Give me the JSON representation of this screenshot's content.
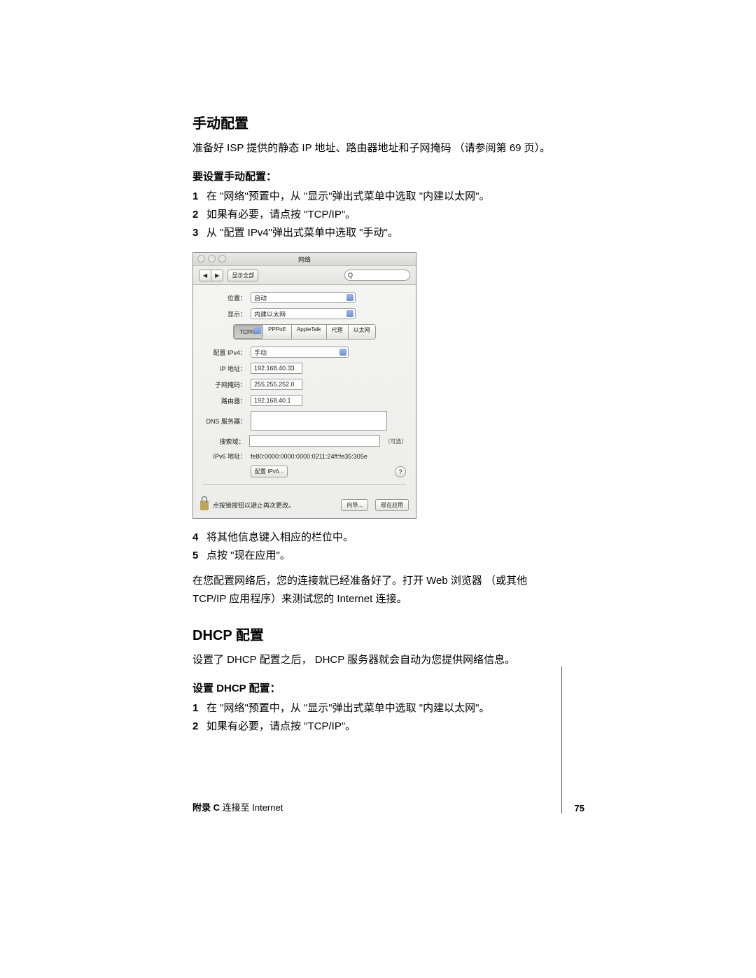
{
  "section1": {
    "title": "手动配置",
    "intro": "准备好 ISP 提供的静态 IP 地址、路由器地址和子网掩码 （请参阅第 69 页）。",
    "subtitle": "要设置手动配置：",
    "steps": [
      "在 \"网络\"预置中，从 \"显示\"弹出式菜单中选取 \"内建以太网\"。",
      "如果有必要，请点按 \"TCP/IP\"。",
      "从 \"配置 IPv4\"弹出式菜单中选取 \"手动\"。"
    ],
    "steps_after": [
      "将其他信息键入相应的栏位中。",
      "点按 \"现在应用\"。"
    ],
    "outro": "在您配置网络后，您的连接就已经准备好了。打开 Web 浏览器 （或其他 TCP/IP 应用程序）来测试您的 Internet 连接。"
  },
  "section2": {
    "title": "DHCP 配置",
    "intro": "设置了 DHCP 配置之后， DHCP 服务器就会自动为您提供网络信息。",
    "subtitle": "设置 DHCP 配置：",
    "steps": [
      "在 \"网络\"预置中，从 \"显示\"弹出式菜单中选取 \"内建以太网\"。",
      "如果有必要，请点按 \"TCP/IP\"。"
    ]
  },
  "shot": {
    "title": "网络",
    "showall": "显示全部",
    "nav_back": "◀",
    "nav_fwd": "▶",
    "search_placeholder": "Q",
    "location_label": "位置：",
    "location_value": "自动",
    "show_label": "显示：",
    "show_value": "内建以太网",
    "tabs": [
      "TCP/IP",
      "PPPoE",
      "AppleTalk",
      "代理",
      "以太网"
    ],
    "ipv4config_label": "配置 IPv4：",
    "ipv4config_value": "手动",
    "ip_label": "IP 地址：",
    "ip_value": "192.168.40.33",
    "subnet_label": "子网掩码：",
    "subnet_value": "255.255.252.0",
    "router_label": "路由器：",
    "router_value": "192.168.40.1",
    "dns_label": "DNS 服务器：",
    "search_label": "搜索域：",
    "optional": "（可选）",
    "ipv6_label": "IPv6 地址：",
    "ipv6_value": "fe80:0000:0000:0000:0211:24ff:fe35:305e",
    "ipv6btn": "配置 IPv6...",
    "lock_text": "点按锁按钮以避止再次更改。",
    "assist_btn": "向导...",
    "apply_btn": "现在应用"
  },
  "footer": {
    "left_bold": "附录 C",
    "left_rest": "   连接至 Internet",
    "page": "75"
  }
}
